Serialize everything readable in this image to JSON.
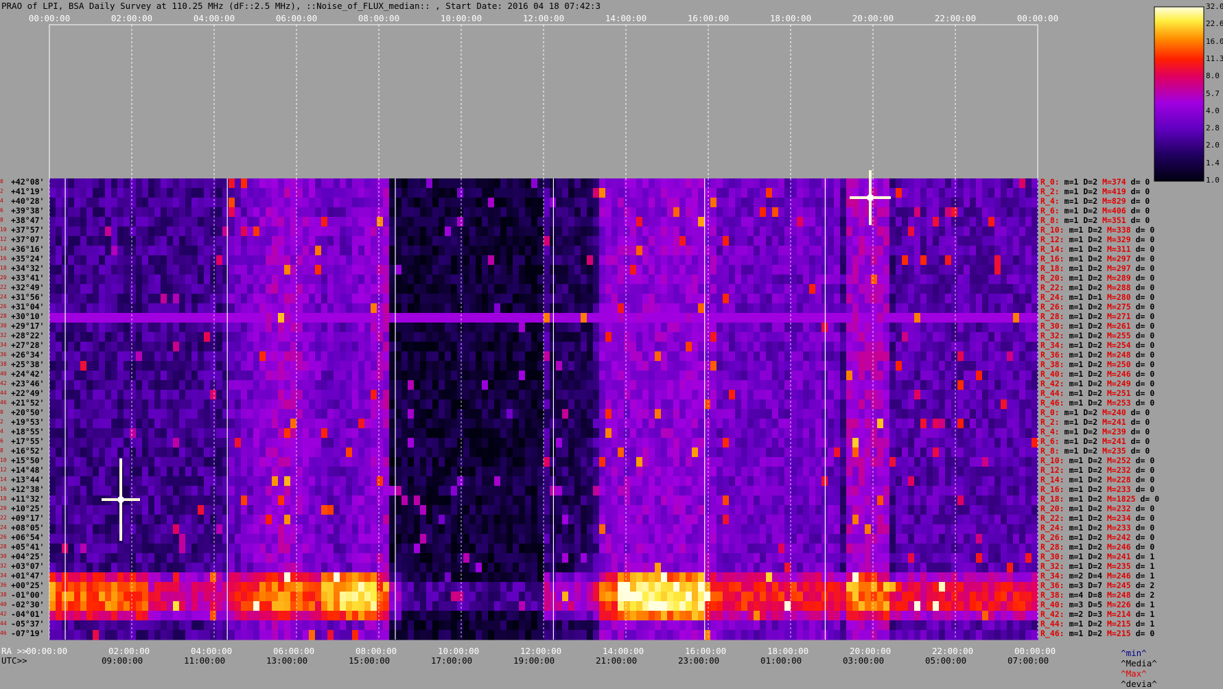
{
  "chart_data": {
    "type": "heatmap",
    "title": "PRAO of LPI, BSA Daily Survey at 110.25 MHz (dF::2.5 MHz), ::Noise_of_FLUX_median:: , Start Date: 2016 04 18 07:42:3",
    "top_ticks": [
      "00:00:00",
      "02:00:00",
      "04:00:00",
      "06:00:00",
      "08:00:00",
      "10:00:00",
      "12:00:00",
      "14:00:00",
      "16:00:00",
      "18:00:00",
      "20:00:00",
      "22:00:00",
      "00:00:00"
    ],
    "ra_label": "RA >>",
    "ra_ticks": [
      "00:00:00",
      "02:00:00",
      "04:00:00",
      "06:00:00",
      "08:00:00",
      "10:00:00",
      "12:00:00",
      "14:00:00",
      "16:00:00",
      "18:00:00",
      "20:00:00",
      "22:00:00",
      "00:00:00"
    ],
    "utc_label": "UTC>>",
    "utc_ticks": [
      "09:00:00",
      "11:00:00",
      "13:00:00",
      "15:00:00",
      "17:00:00",
      "19:00:00",
      "21:00:00",
      "23:00:00",
      "01:00:00",
      "03:00:00",
      "05:00:00",
      "07:00:00"
    ],
    "colorbar_ticks": [
      "32.0",
      "22.6",
      "16.0",
      "11.3",
      "8.0",
      "5.7",
      "4.0",
      "2.8",
      "2.0",
      "1.4",
      "1.0"
    ],
    "declinations": [
      "+42°08'",
      "+41°19'",
      "+40°28'",
      "+39°38'",
      "+38°47'",
      "+37°57'",
      "+37°07'",
      "+36°16'",
      "+35°24'",
      "+34°32'",
      "+33°41'",
      "+32°49'",
      "+31°56'",
      "+31°04'",
      "+30°10'",
      "+29°17'",
      "+28°22'",
      "+27°28'",
      "+26°34'",
      "+25°38'",
      "+24°42'",
      "+23°46'",
      "+22°49'",
      "+21°52'",
      "+20°50'",
      "+19°53'",
      "+18°55'",
      "+17°55'",
      "+16°52'",
      "+15°50'",
      "+14°48'",
      "+13°44'",
      "+12°38'",
      "+11°32'",
      "+10°25'",
      "+09°17'",
      "+08°05'",
      "+06°54'",
      "+05°41'",
      "+04°25'",
      "+03°07'",
      "+01°47'",
      "+00°25'",
      "-01°00'",
      "-02°30'",
      "-04°01'",
      "-05°37'",
      "-07°19'"
    ],
    "row_indices": [
      "0",
      "2",
      "4",
      "6",
      "8",
      "10",
      "12",
      "14",
      "16",
      "18",
      "20",
      "22",
      "24",
      "26",
      "28",
      "30",
      "32",
      "34",
      "36",
      "38",
      "40",
      "42",
      "44",
      "46",
      "0",
      "2",
      "4",
      "6",
      "8",
      "10",
      "12",
      "14",
      "16",
      "18",
      "20",
      "22",
      "24",
      "26",
      "28",
      "30",
      "32",
      "34",
      "36",
      "38",
      "40",
      "42",
      "44",
      "46"
    ],
    "right_labels": [
      {
        "r": "R_0:",
        "m": "m=1",
        "D": "D=2",
        "M": "M=374",
        "d": "d= 0"
      },
      {
        "r": "R_2:",
        "m": "m=1",
        "D": "D=2",
        "M": "M=419",
        "d": "d= 0"
      },
      {
        "r": "R_4:",
        "m": "m=1",
        "D": "D=2",
        "M": "M=829",
        "d": "d= 0"
      },
      {
        "r": "R_6:",
        "m": "m=1",
        "D": "D=2",
        "M": "M=406",
        "d": "d= 0"
      },
      {
        "r": "R_8:",
        "m": "m=1",
        "D": "D=2",
        "M": "M=351",
        "d": "d= 0"
      },
      {
        "r": "R_10:",
        "m": "m=1",
        "D": "D=2",
        "M": "M=338",
        "d": "d= 0"
      },
      {
        "r": "R_12:",
        "m": "m=1",
        "D": "D=2",
        "M": "M=329",
        "d": "d= 0"
      },
      {
        "r": "R_14:",
        "m": "m=1",
        "D": "D=2",
        "M": "M=311",
        "d": "d= 0"
      },
      {
        "r": "R_16:",
        "m": "m=1",
        "D": "D=2",
        "M": "M=297",
        "d": "d= 0"
      },
      {
        "r": "R_18:",
        "m": "m=1",
        "D": "D=2",
        "M": "M=297",
        "d": "d= 0"
      },
      {
        "r": "R_20:",
        "m": "m=1",
        "D": "D=2",
        "M": "M=289",
        "d": "d= 0"
      },
      {
        "r": "R_22:",
        "m": "m=1",
        "D": "D=2",
        "M": "M=288",
        "d": "d= 0"
      },
      {
        "r": "R_24:",
        "m": "m=1",
        "D": "D=1",
        "M": "M=280",
        "d": "d= 0"
      },
      {
        "r": "R_26:",
        "m": "m=1",
        "D": "D=2",
        "M": "M=275",
        "d": "d= 0"
      },
      {
        "r": "R_28:",
        "m": "m=1",
        "D": "D=2",
        "M": "M=271",
        "d": "d= 0"
      },
      {
        "r": "R_30:",
        "m": "m=1",
        "D": "D=2",
        "M": "M=261",
        "d": "d= 0"
      },
      {
        "r": "R_32:",
        "m": "m=1",
        "D": "D=2",
        "M": "M=255",
        "d": "d= 0"
      },
      {
        "r": "R_34:",
        "m": "m=1",
        "D": "D=2",
        "M": "M=254",
        "d": "d= 0"
      },
      {
        "r": "R_36:",
        "m": "m=1",
        "D": "D=2",
        "M": "M=248",
        "d": "d= 0"
      },
      {
        "r": "R_38:",
        "m": "m=1",
        "D": "D=2",
        "M": "M=250",
        "d": "d= 0"
      },
      {
        "r": "R_40:",
        "m": "m=1",
        "D": "D=2",
        "M": "M=246",
        "d": "d= 0"
      },
      {
        "r": "R_42:",
        "m": "m=1",
        "D": "D=2",
        "M": "M=249",
        "d": "d= 0"
      },
      {
        "r": "R_44:",
        "m": "m=1",
        "D": "D=2",
        "M": "M=251",
        "d": "d= 0"
      },
      {
        "r": "R_46:",
        "m": "m=1",
        "D": "D=2",
        "M": "M=253",
        "d": "d= 0"
      },
      {
        "r": "R_0:",
        "m": "m=1",
        "D": "D=2",
        "M": "M=240",
        "d": "d= 0"
      },
      {
        "r": "R_2:",
        "m": "m=1",
        "D": "D=2",
        "M": "M=241",
        "d": "d= 0"
      },
      {
        "r": "R_4:",
        "m": "m=1",
        "D": "D=2",
        "M": "M=239",
        "d": "d= 0"
      },
      {
        "r": "R_6:",
        "m": "m=1",
        "D": "D=2",
        "M": "M=241",
        "d": "d= 0"
      },
      {
        "r": "R_8:",
        "m": "m=1",
        "D": "D=2",
        "M": "M=235",
        "d": "d= 0"
      },
      {
        "r": "R_10:",
        "m": "m=1",
        "D": "D=2",
        "M": "M=252",
        "d": "d= 0"
      },
      {
        "r": "R_12:",
        "m": "m=1",
        "D": "D=2",
        "M": "M=232",
        "d": "d= 0"
      },
      {
        "r": "R_14:",
        "m": "m=1",
        "D": "D=2",
        "M": "M=228",
        "d": "d= 0"
      },
      {
        "r": "R_16:",
        "m": "m=1",
        "D": "D=2",
        "M": "M=233",
        "d": "d= 0"
      },
      {
        "r": "R_18:",
        "m": "m=1",
        "D": "D=2",
        "M": "M=1825",
        "d": "d= 0"
      },
      {
        "r": "R_20:",
        "m": "m=1",
        "D": "D=2",
        "M": "M=232",
        "d": "d= 0"
      },
      {
        "r": "R_22:",
        "m": "m=1",
        "D": "D=2",
        "M": "M=234",
        "d": "d= 0"
      },
      {
        "r": "R_24:",
        "m": "m=1",
        "D": "D=2",
        "M": "M=233",
        "d": "d= 0"
      },
      {
        "r": "R_26:",
        "m": "m=1",
        "D": "D=2",
        "M": "M=242",
        "d": "d= 0"
      },
      {
        "r": "R_28:",
        "m": "m=1",
        "D": "D=2",
        "M": "M=246",
        "d": "d= 0"
      },
      {
        "r": "R_30:",
        "m": "m=1",
        "D": "D=2",
        "M": "M=241",
        "d": "d= 1"
      },
      {
        "r": "R_32:",
        "m": "m=1",
        "D": "D=2",
        "M": "M=235",
        "d": "d= 1"
      },
      {
        "r": "R_34:",
        "m": "m=2",
        "D": "D=4",
        "M": "M=246",
        "d": "d= 1"
      },
      {
        "r": "R_36:",
        "m": "m=3",
        "D": "D=7",
        "M": "M=245",
        "d": "d= 2"
      },
      {
        "r": "R_38:",
        "m": "m=4",
        "D": "D=8",
        "M": "M=248",
        "d": "d= 2"
      },
      {
        "r": "R_40:",
        "m": "m=3",
        "D": "D=5",
        "M": "M=226",
        "d": "d= 1"
      },
      {
        "r": "R_42:",
        "m": "m=2",
        "D": "D=3",
        "M": "M=214",
        "d": "d= 1"
      },
      {
        "r": "R_44:",
        "m": "m=1",
        "D": "D=2",
        "M": "M=215",
        "d": "d= 1"
      },
      {
        "r": "R_46:",
        "m": "m=1",
        "D": "D=2",
        "M": "M=215",
        "d": "d= 0"
      }
    ],
    "legend": [
      "^min^",
      "^Media^",
      "^Max^",
      "^devia^"
    ],
    "colors": {
      "background": "#a0a0a0",
      "plot_bg": "#1a0840",
      "low": "#000010",
      "mid": "#8a00ff",
      "high": "#ff2000",
      "peak": "#ffffc0"
    }
  }
}
